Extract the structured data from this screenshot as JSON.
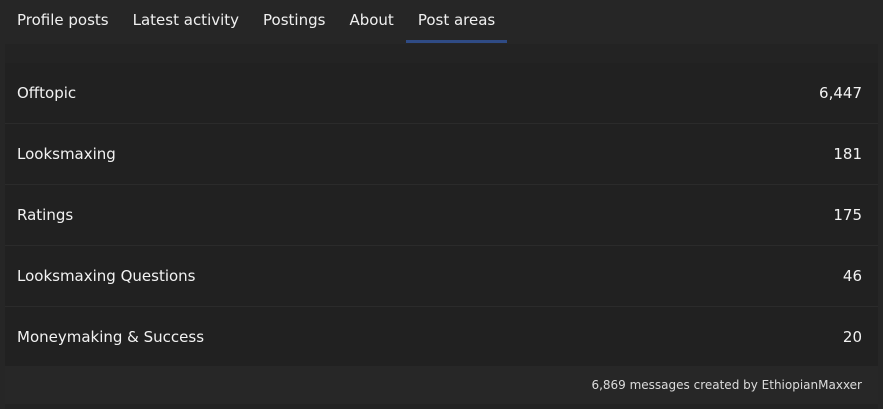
{
  "tabs": [
    {
      "label": "Profile posts"
    },
    {
      "label": "Latest activity"
    },
    {
      "label": "Postings"
    },
    {
      "label": "About"
    },
    {
      "label": "Post areas"
    }
  ],
  "active_tab_index": 4,
  "areas": [
    {
      "name": "Offtopic",
      "count": "6,447"
    },
    {
      "name": "Looksmaxing",
      "count": "181"
    },
    {
      "name": "Ratings",
      "count": "175"
    },
    {
      "name": "Looksmaxing Questions",
      "count": "46"
    },
    {
      "name": "Moneymaking & Success",
      "count": "20"
    }
  ],
  "footer": {
    "text": "6,869 messages created by EthiopianMaxxer"
  },
  "colors": {
    "active_tab_underline": "#2f4b85",
    "background": "#232323"
  }
}
